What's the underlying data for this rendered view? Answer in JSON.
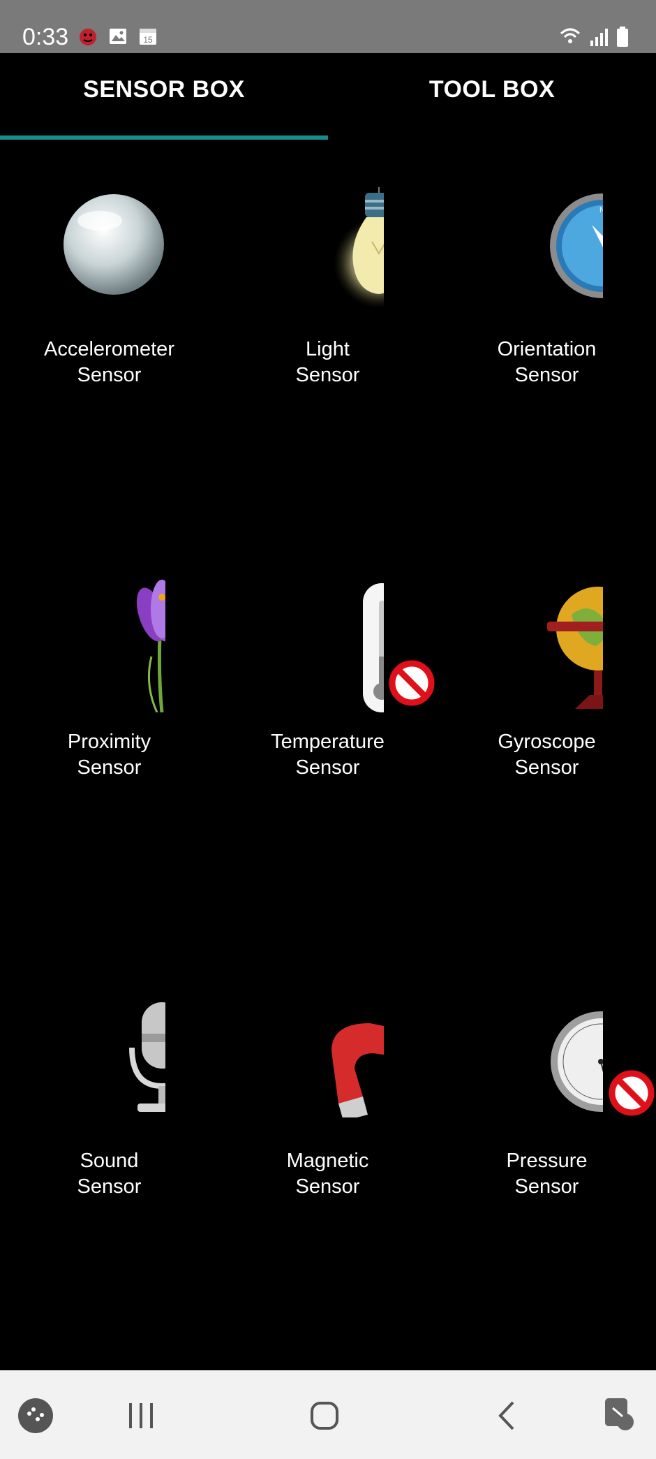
{
  "status_bar": {
    "time": "0:33",
    "calendar_day": "15"
  },
  "tabs": [
    {
      "label": "SENSOR BOX",
      "selected": true
    },
    {
      "label": "TOOL BOX",
      "selected": false
    }
  ],
  "colors": {
    "tab_indicator": "#1a8a8a",
    "status_bar": "#7a7a7a",
    "nav_bar": "#f2f2f2"
  },
  "sensors": [
    {
      "line1": "Accelerometer",
      "line2": "Sensor",
      "icon": "glass-sphere-icon",
      "available": true
    },
    {
      "line1": "Light",
      "line2": "Sensor",
      "icon": "light-bulb-icon",
      "available": true
    },
    {
      "line1": "Orientation",
      "line2": "Sensor",
      "icon": "compass-icon",
      "available": true
    },
    {
      "line1": "Proximity",
      "line2": "Sensor",
      "icon": "crocus-flower-icon",
      "available": true
    },
    {
      "line1": "Temperature",
      "line2": "Sensor",
      "icon": "thermometer-icon",
      "available": false
    },
    {
      "line1": "Gyroscope",
      "line2": "Sensor",
      "icon": "globe-gyroscope-icon",
      "available": true
    },
    {
      "line1": "Sound",
      "line2": "Sensor",
      "icon": "microphone-icon",
      "available": true
    },
    {
      "line1": "Magnetic",
      "line2": "Sensor",
      "icon": "magnet-icon",
      "available": true
    },
    {
      "line1": "Pressure",
      "line2": "Sensor",
      "icon": "barometer-icon",
      "available": false
    }
  ],
  "nav_bar": [
    "game-launcher-icon",
    "recent-apps-icon",
    "home-icon",
    "back-icon",
    "screen-tap-icon"
  ]
}
